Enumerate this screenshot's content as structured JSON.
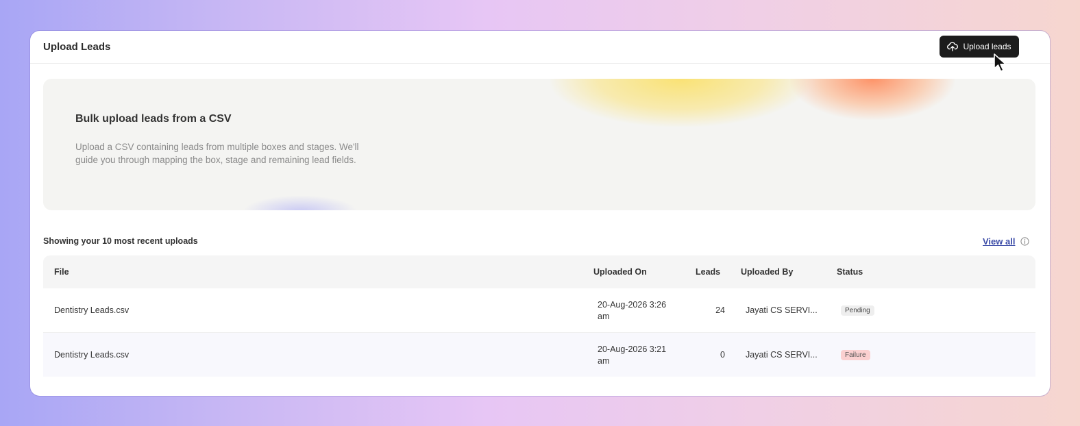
{
  "header": {
    "title": "Upload Leads",
    "upload_button_label": "Upload leads",
    "upload_icon": "cloud-upload-icon"
  },
  "hero": {
    "title": "Bulk upload leads from a CSV",
    "description": "Upload a CSV containing leads from multiple boxes and stages. We'll guide you through mapping the box, stage and remaining lead fields."
  },
  "recent": {
    "label": "Showing your 10 most recent uploads",
    "view_all_label": "View all",
    "info_icon": "info-icon"
  },
  "table": {
    "columns": {
      "file": "File",
      "uploaded_on": "Uploaded On",
      "leads": "Leads",
      "uploaded_by": "Uploaded By",
      "status": "Status"
    },
    "rows": [
      {
        "file": "Dentistry Leads.csv",
        "uploaded_on": "20-Aug-2026 3:26 am",
        "leads": "24",
        "uploaded_by": "Jayati CS SERVI...",
        "status": "Pending"
      },
      {
        "file": "Dentistry Leads.csv",
        "uploaded_on": "20-Aug-2026 3:21 am",
        "leads": "0",
        "uploaded_by": "Jayati CS SERVI...",
        "status": "Failure"
      }
    ]
  },
  "colors": {
    "button_bg": "#1c1c1c",
    "link": "#3d4da8",
    "pending_badge": "#eeeeee",
    "failure_badge": "#fbd0d0"
  }
}
